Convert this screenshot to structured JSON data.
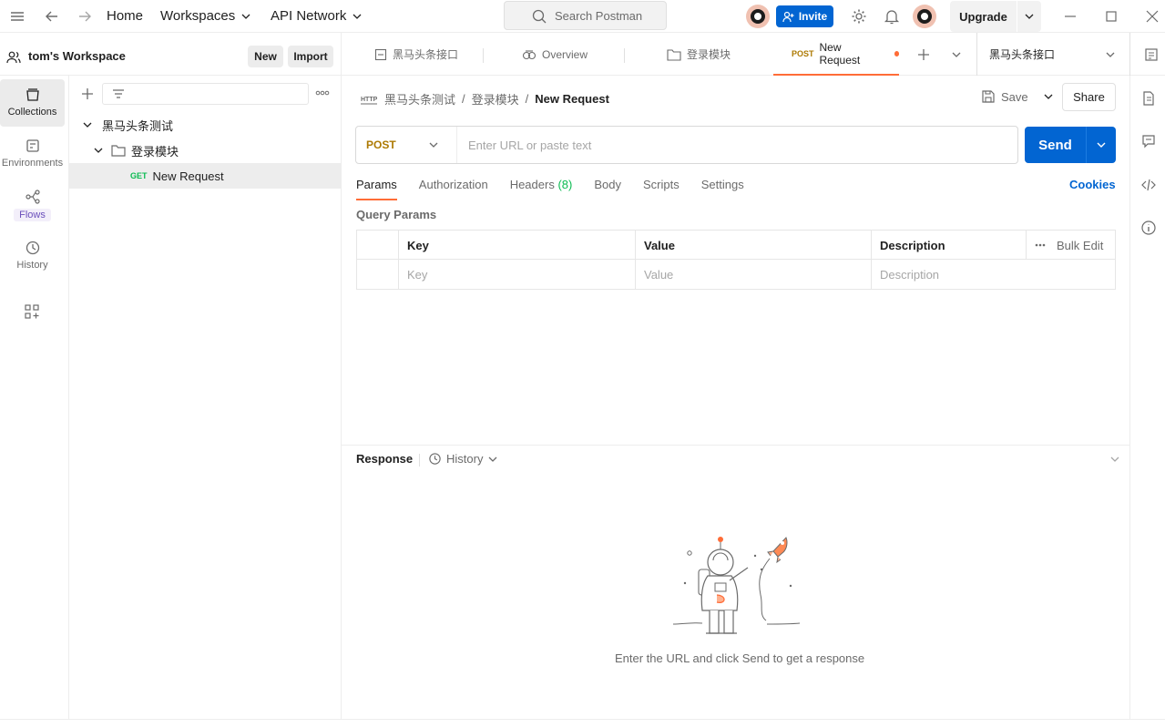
{
  "topbar": {
    "nav": {
      "home": "Home",
      "workspaces": "Workspaces",
      "api_network": "API Network"
    },
    "search_placeholder": "Search Postman",
    "invite_label": "Invite",
    "upgrade_label": "Upgrade"
  },
  "workspace": {
    "title": "tom's Workspace",
    "new_label": "New",
    "import_label": "Import"
  },
  "rail": {
    "items": [
      {
        "label": "Collections",
        "icon": "collections-icon",
        "active": true
      },
      {
        "label": "Environments",
        "icon": "environments-icon"
      },
      {
        "label": "Flows",
        "icon": "flows-icon"
      },
      {
        "label": "History",
        "icon": "history-icon"
      }
    ]
  },
  "tree": {
    "collection": "黑马头条测试",
    "folder": "登录模块",
    "request": {
      "method": "GET",
      "name": "New Request"
    }
  },
  "tabs": [
    {
      "label": "黑马头条接口",
      "icon": "api-icon"
    },
    {
      "label": "Overview",
      "icon": "overview-icon"
    },
    {
      "label": "登录模块",
      "icon": "folder-icon"
    },
    {
      "method": "POST",
      "label": "New Request",
      "active": true,
      "unsaved": true
    }
  ],
  "environment_select": "黑马头条接口",
  "breadcrumb": {
    "collection": "黑马头条测试",
    "folder": "登录模块",
    "current": "New Request",
    "separator": "/"
  },
  "actions": {
    "save_label": "Save",
    "share_label": "Share"
  },
  "request": {
    "method": "POST",
    "url_placeholder": "Enter URL or paste text",
    "send_label": "Send"
  },
  "request_tabs": {
    "params": "Params",
    "authorization": "Authorization",
    "headers": "Headers",
    "headers_count": "(8)",
    "body": "Body",
    "scripts": "Scripts",
    "settings": "Settings",
    "cookies": "Cookies"
  },
  "query_params": {
    "title": "Query Params",
    "headers": {
      "key": "Key",
      "value": "Value",
      "description": "Description",
      "bulk_edit": "Bulk Edit"
    },
    "placeholder_row": {
      "key": "Key",
      "value": "Value",
      "description": "Description"
    }
  },
  "response": {
    "title": "Response",
    "history_label": "History",
    "empty_hint": "Enter the URL and click Send to get a response"
  },
  "colors": {
    "accent": "#ff6c37",
    "primary": "#0265d2",
    "get": "#0cbb52",
    "post": "#ad7a03"
  }
}
